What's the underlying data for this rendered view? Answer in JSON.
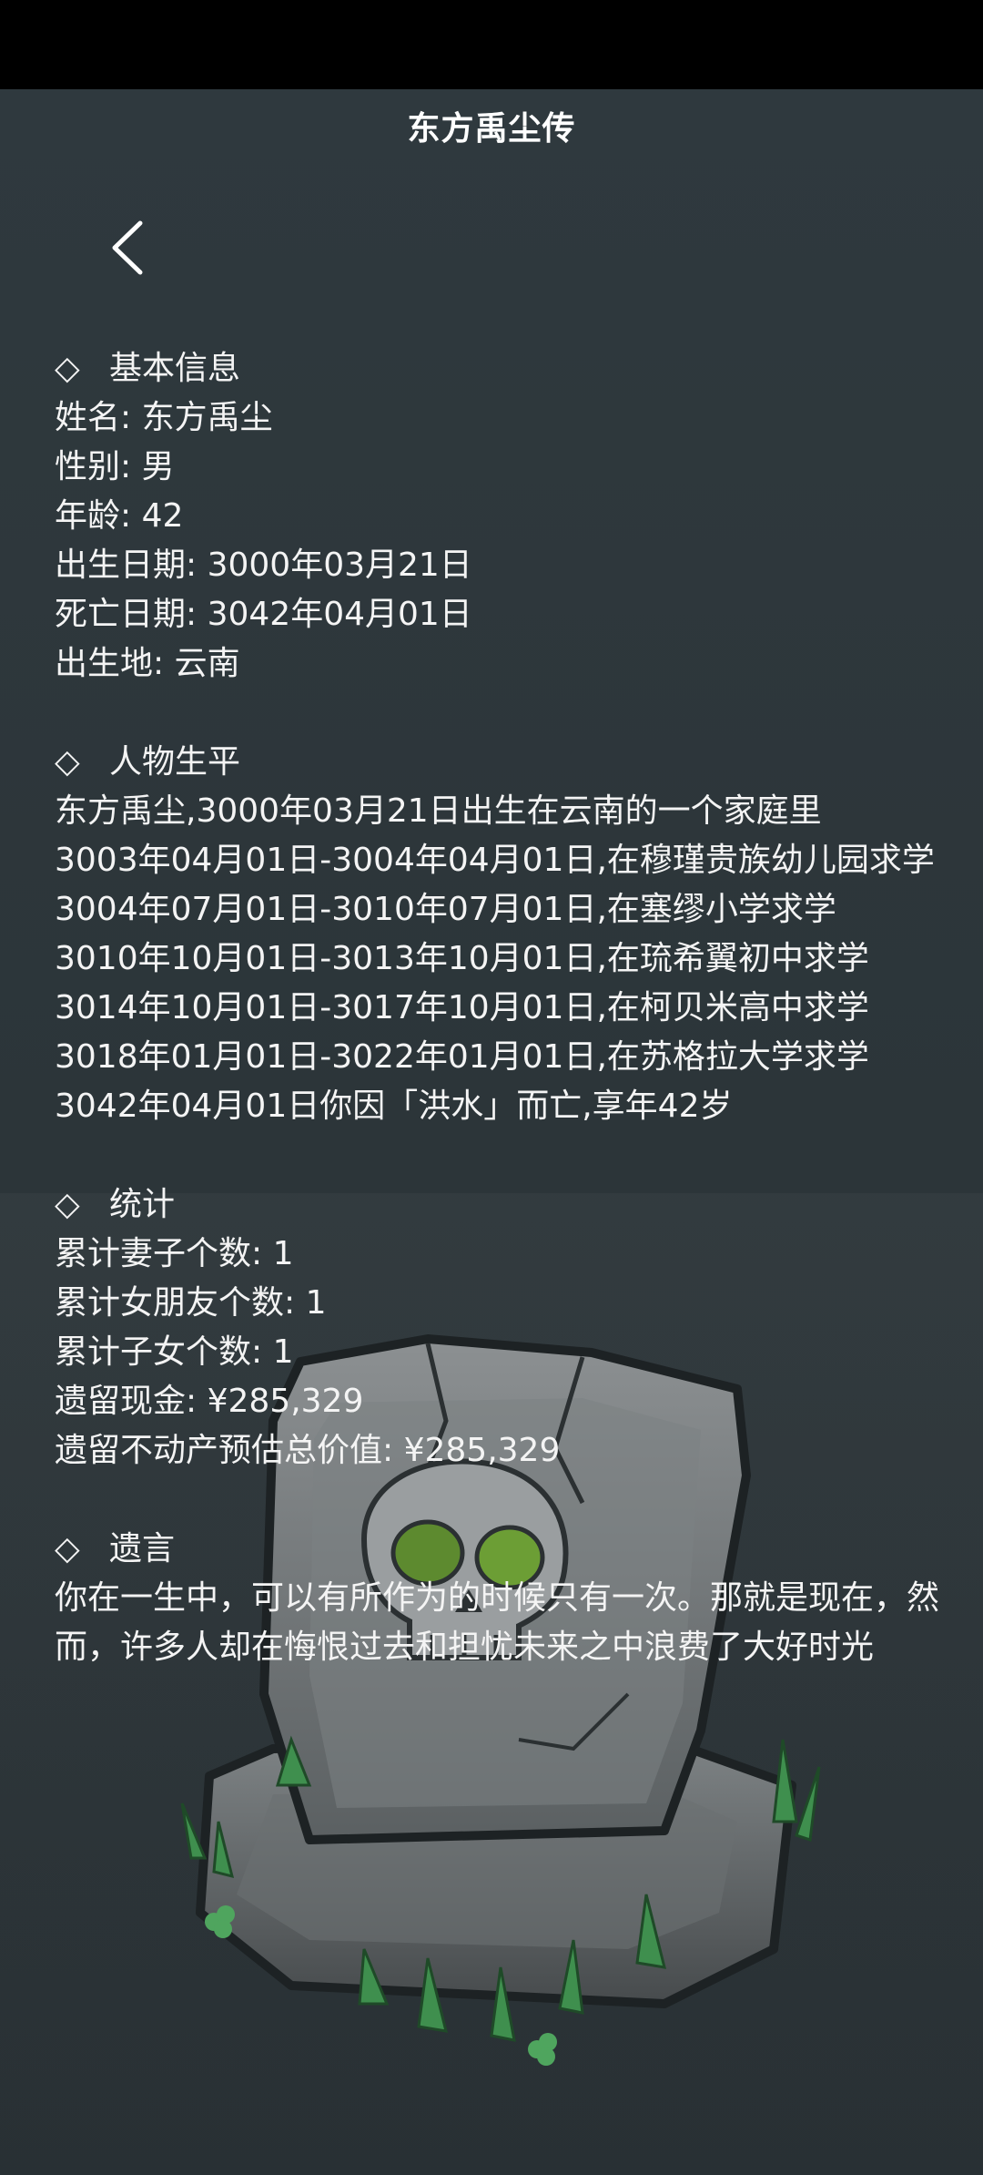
{
  "header": {
    "title": "东方禹尘传"
  },
  "basic": {
    "heading_icon": "◇",
    "heading": "基本信息",
    "lines": [
      "姓名: 东方禹尘",
      "性别: 男",
      "年龄: 42",
      "出生日期: 3000年03月21日",
      "死亡日期: 3042年04月01日",
      "出生地: 云南"
    ]
  },
  "life": {
    "heading_icon": "◇",
    "heading": "人物生平",
    "lines": [
      "东方禹尘,3000年03月21日出生在云南的一个家庭里",
      "3003年04月01日-3004年04月01日,在穆瑾贵族幼儿园求学",
      "3004年07月01日-3010年07月01日,在塞缪小学求学",
      "3010年10月01日-3013年10月01日,在琉希翼初中求学",
      "3014年10月01日-3017年10月01日,在柯贝米高中求学",
      "3018年01月01日-3022年01月01日,在苏格拉大学求学",
      "3042年04月01日你因「洪水」而亡,享年42岁"
    ]
  },
  "stats": {
    "heading_icon": "◇",
    "heading": "统计",
    "lines": [
      "累计妻子个数: 1",
      "累计女朋友个数: 1",
      "累计子女个数: 1",
      "遗留现金: ¥285,329",
      "遗留不动产预估总价值: ¥285,329"
    ]
  },
  "will": {
    "heading_icon": "◇",
    "heading": "遗言",
    "text": "你在一生中，可以有所作为的时候只有一次。那就是现在，然而，许多人却在悔恨过去和担忧未来之中浪费了大好时光"
  },
  "icons": {
    "back": "back-arrow-icon",
    "tombstone": "tombstone-skull-icon"
  }
}
